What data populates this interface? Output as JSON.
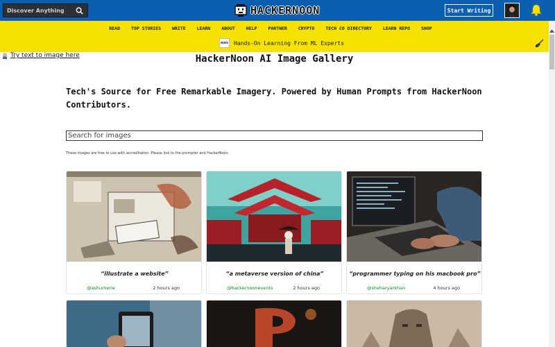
{
  "header": {
    "search_placeholder": "Discover Anything",
    "logo_text": "HACKERNOON",
    "start_writing_label": "Start Writing"
  },
  "nav": {
    "links": [
      "READ",
      "TOP STORIES",
      "WRITE",
      "LEARN",
      "ABOUT",
      "HELP",
      "PARTNER",
      "CRYPTO",
      "TECH CO DIRECTORY",
      "LEARN REPO",
      "SHOP"
    ],
    "promo_badge": "aws",
    "promo_text": "Hands-On Learning From ML Experts"
  },
  "main": {
    "try_link": "Try text to image here",
    "title": "HackerNoon AI Image Gallery",
    "tagline": "Tech's Source for Free Remarkable Imagery. Powered by Human Prompts from HackerNoon Contributors.",
    "search_placeholder": "Search for images",
    "notice": "These images are free to use with accreditation. Please link to the prompter and HackerNoon."
  },
  "cards": [
    {
      "caption": "“illustrate a website”",
      "author": "@ashumerie",
      "time": "2 hours ago"
    },
    {
      "caption": "“a metaverse version of china”",
      "author": "@hackernoonevents",
      "time": "2 hours ago"
    },
    {
      "caption": "“programmer typing on his macbook pro”",
      "author": "@sheharyarkhan",
      "time": "4 hours ago"
    }
  ],
  "colors": {
    "topbar": "#0b5fb0",
    "navbar": "#f5e200",
    "author_green": "#0a8a2a"
  },
  "icons": {
    "search": "search-icon",
    "bell": "bell-icon",
    "broom": "broom-icon",
    "logo": "hackernoon-logo-icon"
  }
}
